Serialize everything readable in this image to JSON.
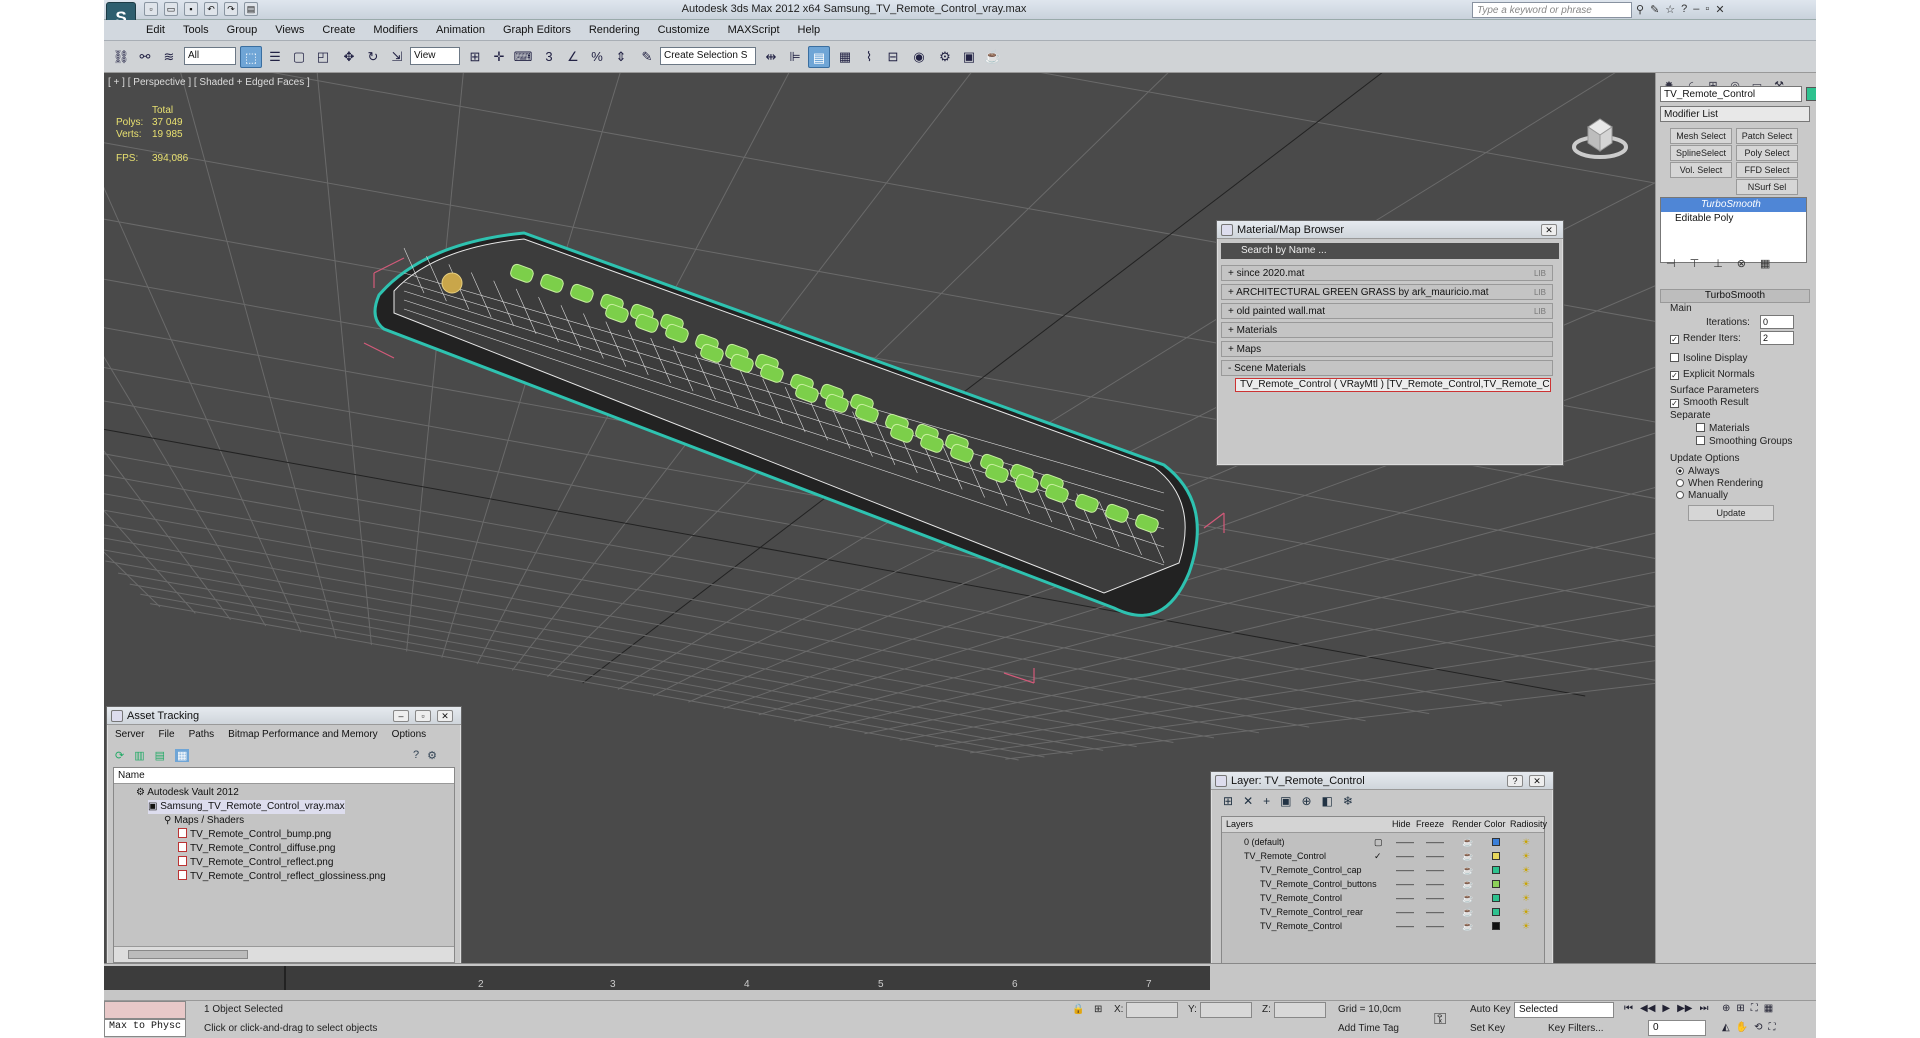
{
  "app": {
    "title": "Autodesk 3ds Max 2012 x64     Samsung_TV_Remote_Control_vray.max",
    "logo": "S",
    "search_placeholder": "Type a keyword or phrase"
  },
  "menu": [
    "Edit",
    "Tools",
    "Group",
    "Views",
    "Create",
    "Modifiers",
    "Animation",
    "Graph Editors",
    "Rendering",
    "Customize",
    "MAXScript",
    "Help"
  ],
  "toolbar": {
    "selection_filter": "All",
    "ref_coord": "View",
    "named_selection": "Create Selection S"
  },
  "viewport": {
    "label": "[ + ] [ Perspective ] [ Shaded + Edged Faces ]",
    "stats": {
      "total_label": "Total",
      "polys_label": "Polys:",
      "polys": "37 049",
      "verts_label": "Verts:",
      "verts": "19 985",
      "fps_label": "FPS:",
      "fps": "394,086"
    }
  },
  "command_panel": {
    "object_name": "TV_Remote_Control",
    "modifier_list": "Modifier List",
    "buttons": [
      "Mesh Select",
      "Patch Select",
      "SplineSelect",
      "Poly Select",
      "Vol. Select",
      "FFD Select",
      "NSurf Sel"
    ],
    "stack": [
      "TurboSmooth",
      "Editable Poly"
    ],
    "turbosmooth": {
      "title": "TurboSmooth",
      "main": "Main",
      "iterations_label": "Iterations:",
      "iterations": "0",
      "render_iters_label": "Render Iters:",
      "render_iters": "2",
      "isoline": "Isoline Display",
      "explicit_normals": "Explicit Normals",
      "surface_params": "Surface Parameters",
      "smooth_result": "Smooth Result",
      "separate": "Separate",
      "materials": "Materials",
      "smoothing_groups": "Smoothing Groups",
      "update_options": "Update Options",
      "always": "Always",
      "when_rendering": "When Rendering",
      "manually": "Manually",
      "update": "Update"
    }
  },
  "material_browser": {
    "title": "Material/Map Browser",
    "search": "Search by Name ...",
    "rows": [
      "+ since 2020.mat",
      "+ ARCHITECTURAL GREEN GRASS by ark_mauricio.mat",
      "+ old painted wall.mat",
      "+ Materials",
      "+ Maps",
      "- Scene Materials"
    ],
    "lib": "LIB",
    "selected_item": "TV_Remote_Control  ( VRayMtl ) [TV_Remote_Control,TV_Remote_Control_butt..."
  },
  "asset_tracking": {
    "title": "Asset Tracking",
    "menu": [
      "Server",
      "File",
      "Paths",
      "Bitmap Performance and Memory",
      "Options"
    ],
    "column": "Name",
    "items": [
      "Autodesk Vault 2012",
      "Samsung_TV_Remote_Control_vray.max",
      "Maps / Shaders",
      "TV_Remote_Control_bump.png",
      "TV_Remote_Control_diffuse.png",
      "TV_Remote_Control_reflect.png",
      "TV_Remote_Control_reflect_glossiness.png"
    ]
  },
  "layer_dialog": {
    "title": "Layer: TV_Remote_Control",
    "columns": [
      "Layers",
      "Hide",
      "Freeze",
      "Render",
      "Color",
      "Radiosity"
    ],
    "layers": [
      {
        "name": "0 (default)",
        "color": "#3a7fd9"
      },
      {
        "name": "TV_Remote_Control",
        "color": "#e6d65c"
      },
      {
        "name": "TV_Remote_Control_cap",
        "color": "#2ec28f"
      },
      {
        "name": "TV_Remote_Control_buttons",
        "color": "#8cd15a"
      },
      {
        "name": "TV_Remote_Control",
        "color": "#2ec28f"
      },
      {
        "name": "TV_Remote_Control_rear",
        "color": "#2ec28f"
      },
      {
        "name": "TV_Remote_Control",
        "color": "#111111"
      }
    ],
    "dash": "——"
  },
  "timeline": {
    "ticks": [
      "2",
      "3",
      "4",
      "5",
      "6",
      "7"
    ]
  },
  "status": {
    "maxscript": "Max to Physc",
    "selected": "1 Object Selected",
    "prompt": "Click or click-and-drag to select objects",
    "x_label": "X:",
    "y_label": "Y:",
    "z_label": "Z:",
    "grid": "Grid = 10,0cm",
    "add_time_tag": "Add Time Tag",
    "auto_key": "Auto Key",
    "selected_dropdown": "Selected",
    "set_key": "Set Key",
    "key_filters": "Key Filters...",
    "frame": "0"
  }
}
